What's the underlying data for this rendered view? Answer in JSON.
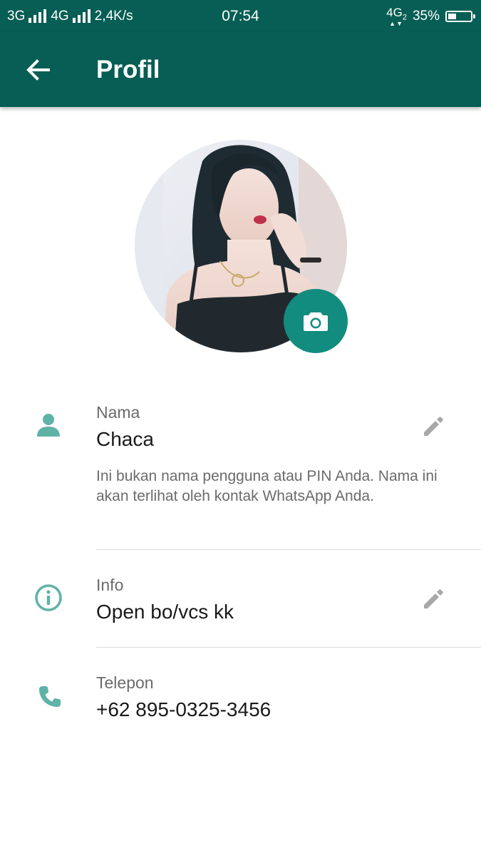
{
  "status_bar": {
    "net1": "3G",
    "net2": "4G",
    "speed": "2,4K/s",
    "time": "07:54",
    "net3": "4G",
    "net3_sim": "2",
    "battery_percent_text": "35%",
    "battery_level": 0.35
  },
  "app_bar": {
    "title": "Profil",
    "back_icon": "arrow-left-icon"
  },
  "profile": {
    "avatar": "profile-photo",
    "camera_icon": "camera-icon"
  },
  "fields": {
    "name": {
      "label": "Nama",
      "value": "Chaca",
      "hint": "Ini bukan nama pengguna atau PIN Anda. Nama ini akan terlihat oleh kontak WhatsApp Anda.",
      "icon": "person-icon"
    },
    "info": {
      "label": "Info",
      "value": "Open bo/vcs kk",
      "icon": "info-icon"
    },
    "phone": {
      "label": "Telepon",
      "value": "+62 895-0325-3456",
      "icon": "phone-icon"
    }
  },
  "colors": {
    "header": "#075e54",
    "accent": "#128c7e",
    "icon_teal": "#5fb3a6"
  }
}
